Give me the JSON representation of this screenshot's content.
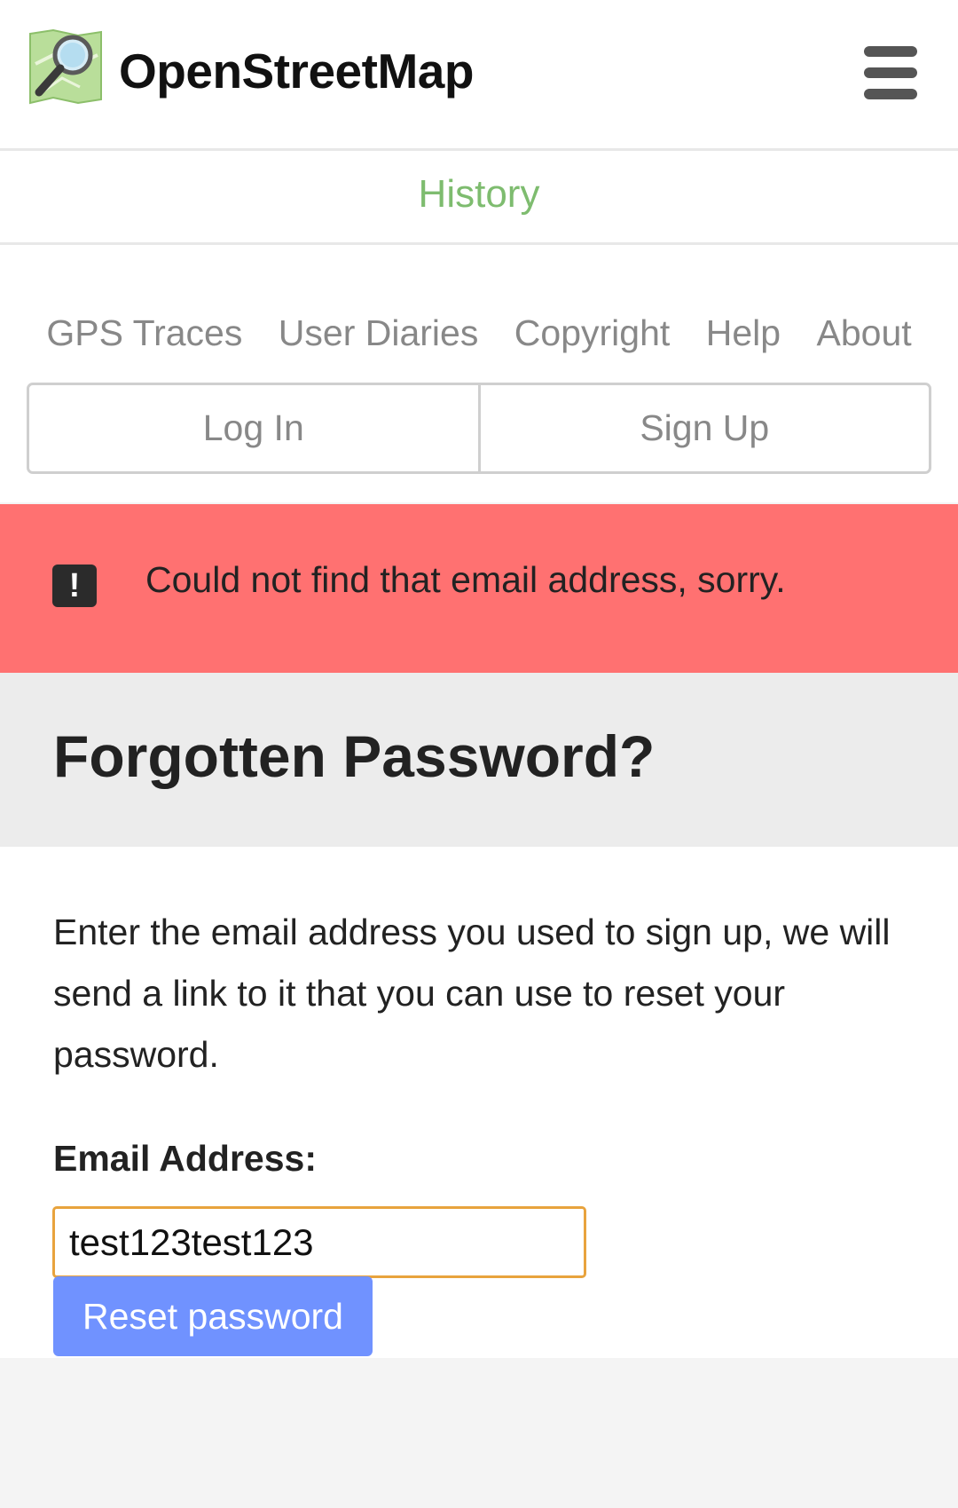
{
  "header": {
    "brand": "OpenStreetMap",
    "logo_icon": "osm-map-magnifier-logo",
    "menu_icon": "hamburger-menu-icon"
  },
  "nav": {
    "history": "History",
    "links": [
      "GPS Traces",
      "User Diaries",
      "Copyright",
      "Help",
      "About"
    ],
    "login": "Log In",
    "signup": "Sign Up"
  },
  "flash": {
    "icon": "exclamation-icon",
    "message": "Could not find that email address, sorry."
  },
  "page": {
    "title": "Forgotten Password?",
    "intro": "Enter the email address you used to sign up, we will send a link to it that you can use to reset your password.",
    "email_label": "Email Address:",
    "email_value": "test123test123",
    "submit_label": "Reset password"
  },
  "colors": {
    "brand_green": "#7ebc6f",
    "flash_red": "#ff7171",
    "button_blue": "#7092ff",
    "focus_orange": "#e8a33d"
  }
}
